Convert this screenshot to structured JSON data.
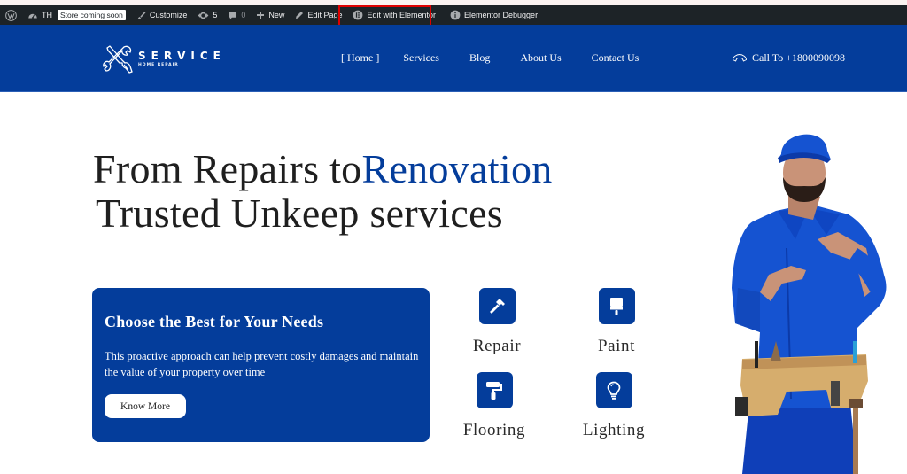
{
  "admin_bar": {
    "site_name": "TH",
    "store_badge": "Store coming soon",
    "customize": "Customize",
    "updates_count": "5",
    "comments_count": "0",
    "new": "New",
    "edit_page": "Edit Page",
    "edit_with_elementor": "Edit with Elementor",
    "elementor_debugger": "Elementor Debugger"
  },
  "header": {
    "logo_title": "SERVICE",
    "logo_subtitle": "HOME REPAIR",
    "nav": [
      "[ Home ]",
      "Services",
      "Blog",
      "About Us",
      "Contact Us"
    ],
    "call_label": "Call To +1800090098"
  },
  "hero": {
    "title_part1": "From Repairs to",
    "title_accent": "Renovation",
    "title_line2": "Trusted Unkeep services"
  },
  "card": {
    "title": "Choose the Best for Your Needs",
    "text": "This proactive approach can help prevent costly damages and maintain the value of your property over time",
    "button": "Know More"
  },
  "services": [
    {
      "label": "Repair",
      "icon": "hammer-icon"
    },
    {
      "label": "Paint",
      "icon": "paint-brush-icon"
    },
    {
      "label": "Flooring",
      "icon": "paint-roller-icon"
    },
    {
      "label": "Lighting",
      "icon": "lightbulb-icon"
    }
  ],
  "colors": {
    "brand_blue": "#043d9b",
    "admin_bar": "#1d2327",
    "highlight_red": "#e00000",
    "heading_text": "#1f1f1f"
  }
}
